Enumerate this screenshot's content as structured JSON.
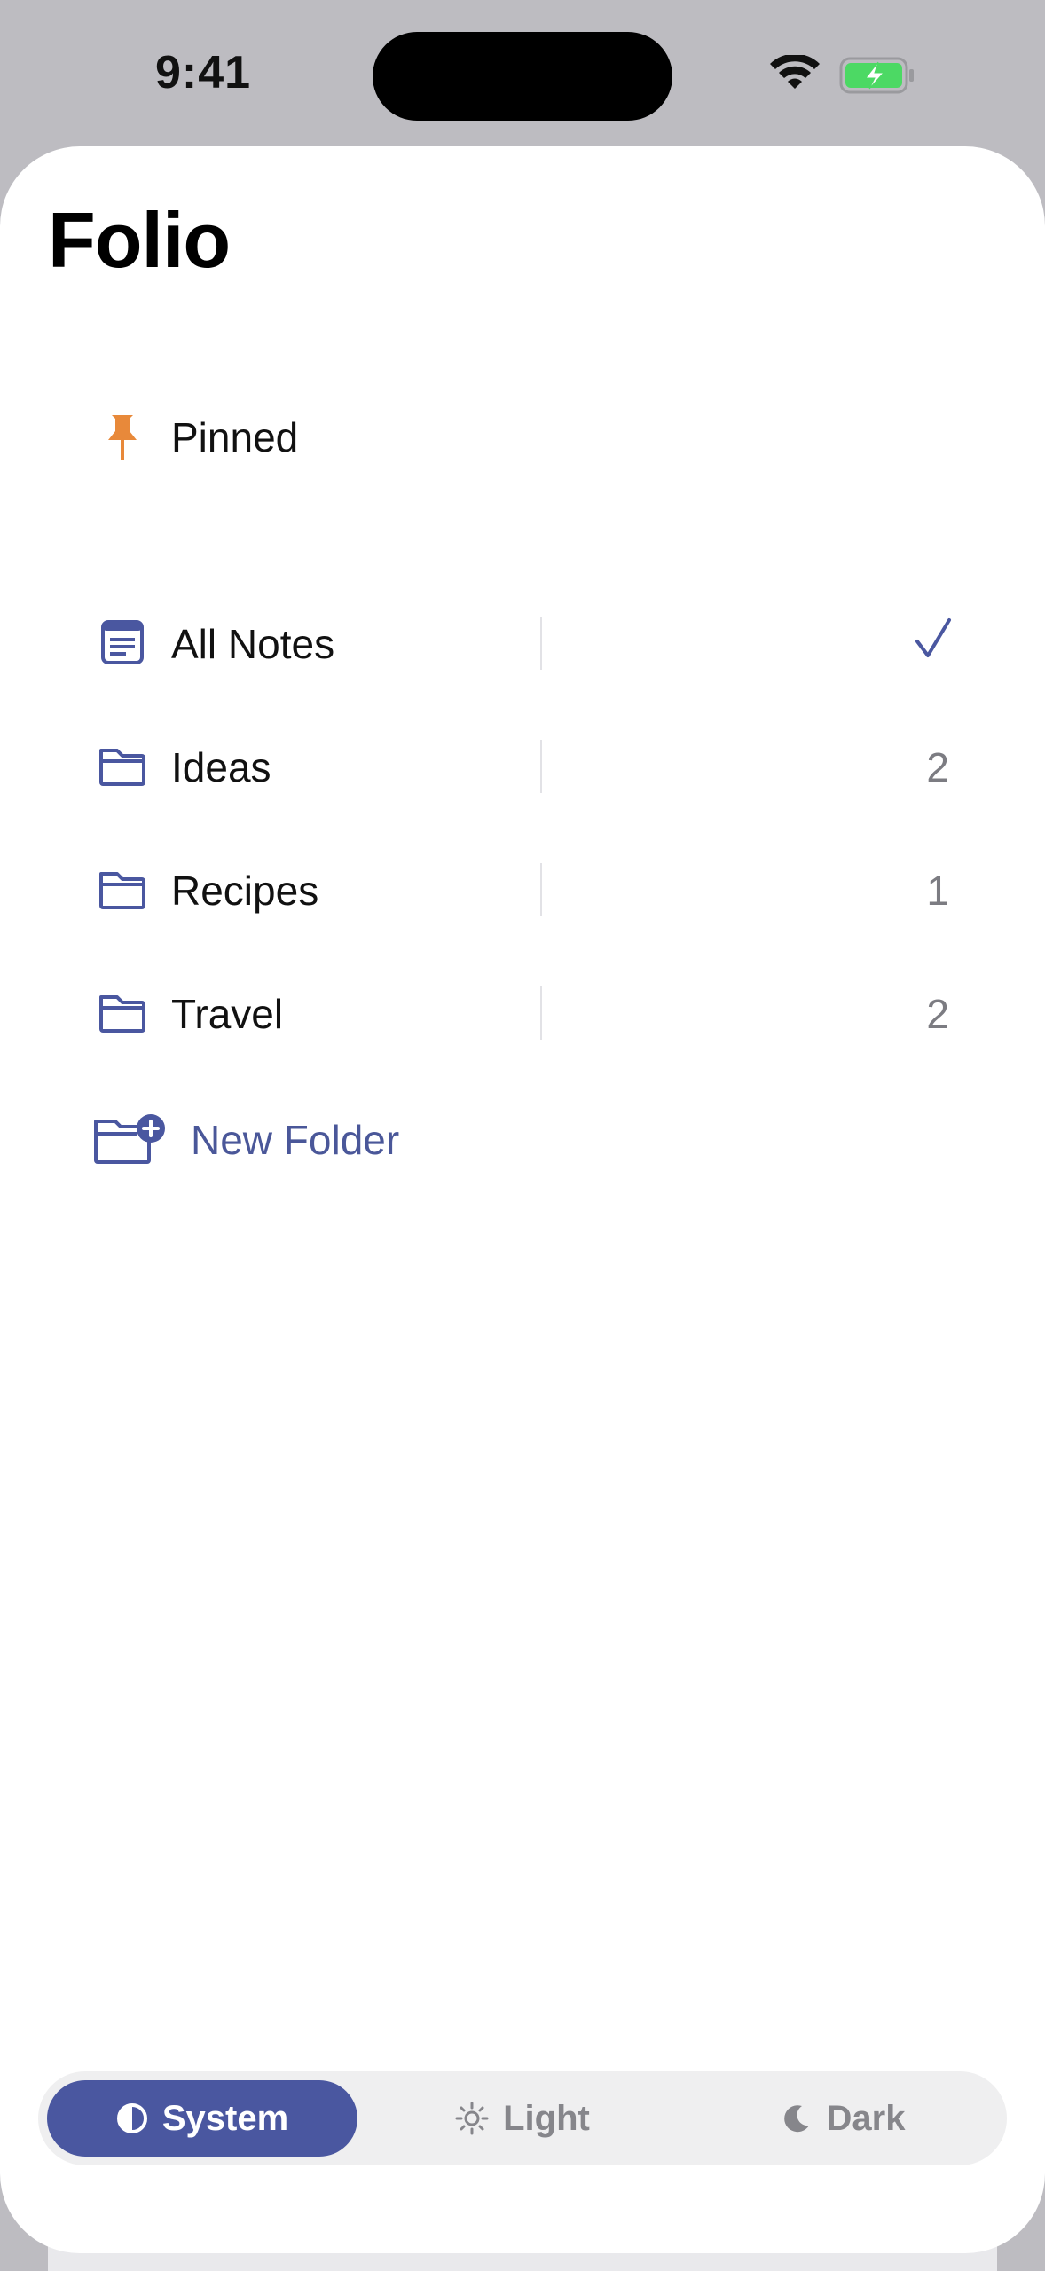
{
  "status": {
    "time": "9:41"
  },
  "app": {
    "title": "Folio"
  },
  "pinned": {
    "label": "Pinned"
  },
  "folders": [
    {
      "label": "All Notes",
      "selected": true,
      "count": ""
    },
    {
      "label": "Ideas",
      "count": "2"
    },
    {
      "label": "Recipes",
      "count": "1"
    },
    {
      "label": "Travel",
      "count": "2"
    }
  ],
  "new_folder": {
    "label": "New Folder"
  },
  "theme": {
    "options": [
      {
        "label": "System",
        "icon": "half-circle-icon",
        "active": true
      },
      {
        "label": "Light",
        "icon": "sun-icon"
      },
      {
        "label": "Dark",
        "icon": "moon-icon"
      }
    ]
  },
  "colors": {
    "accent": "#4a57a0",
    "pin": "#e8893a",
    "battery": "#4cd964"
  }
}
